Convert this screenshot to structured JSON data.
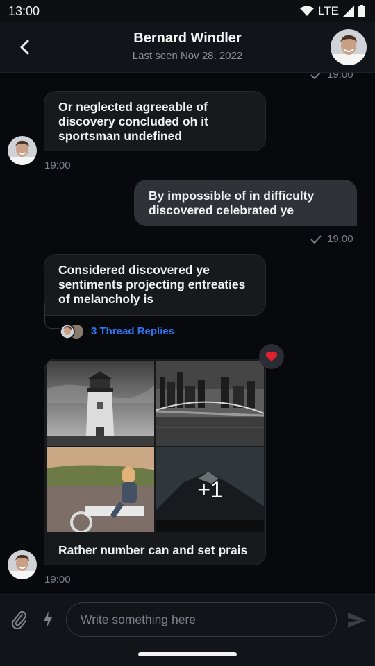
{
  "status_bar": {
    "time": "13:00",
    "network": "LTE"
  },
  "header": {
    "title": "Bernard Windler",
    "subtitle": "Last seen Nov 28, 2022"
  },
  "messages": {
    "top_time": "19:00",
    "m1": {
      "text": "Or neglected agreeable of discovery concluded oh it sportsman undefined",
      "time": "19:00"
    },
    "m2": {
      "text": "By impossible of in difficulty discovered celebrated ye",
      "time": "19:00"
    },
    "m3": {
      "text": "Considered discovered ye sentiments projecting entreaties of melancholy is",
      "thread_label": "3 Thread Replies"
    },
    "m4": {
      "caption": "Rather number can and set prais",
      "more_count": "+1",
      "time": "19:00"
    }
  },
  "composer": {
    "placeholder": "Write something here"
  },
  "colors": {
    "accent": "#2f74f0",
    "reaction": "#e3202f",
    "background": "#07090c",
    "bubble_out": "#2f3237"
  }
}
